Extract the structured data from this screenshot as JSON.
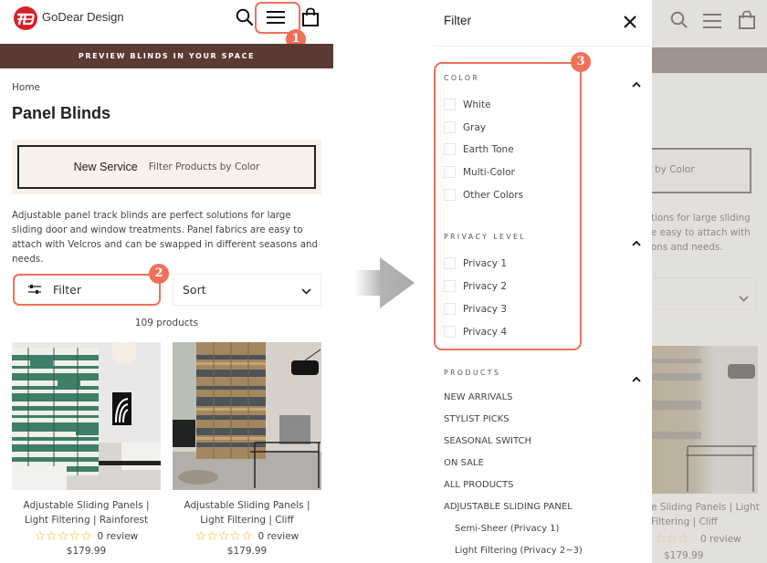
{
  "header": {
    "brand": "GoDear Design",
    "icons": [
      "search-icon",
      "menu-icon",
      "bag-icon"
    ]
  },
  "annotations": {
    "badge_1": "1",
    "badge_2": "2",
    "badge_3": "3",
    "accent_color": "#f0705a"
  },
  "promo_bar": {
    "text": "PREVIEW BLINDS IN YOUR SPACE",
    "color": "#5b3a33"
  },
  "breadcrumb": "Home",
  "page_title": "Panel Blinds",
  "service_banner": {
    "title": "New Service",
    "subtitle": "Filter Products by Color"
  },
  "description": "Adjustable panel track blinds are perfect solutions for large sliding door and window treatments. Panel fabrics are easy to attach with Velcros and can be swapped in different seasons and needs.",
  "toolbar": {
    "filter_label": "Filter",
    "sort_label": "Sort"
  },
  "product_count": "109 products",
  "products": [
    {
      "name": "Adjustable Sliding Panels | Light Filtering | Rainforest",
      "stars": "☆☆☆☆☆",
      "rating": 0,
      "reviews": "0 review",
      "price": "$179.99"
    },
    {
      "name": "Adjustable Sliding Panels | Light Filtering | Cliff",
      "stars": "☆☆☆☆☆",
      "rating": 0,
      "reviews": "0 review",
      "price": "$179.99"
    }
  ],
  "filter_drawer": {
    "title": "Filter",
    "sections": [
      {
        "heading": "COLOR",
        "options": [
          "White",
          "Gray",
          "Earth Tone",
          "Multi-Color",
          "Other Colors"
        ]
      },
      {
        "heading": "PRIVACY LEVEL",
        "options": [
          "Privacy 1",
          "Privacy 2",
          "Privacy 3",
          "Privacy 4"
        ]
      },
      {
        "heading": "PRODUCTS",
        "links": [
          "NEW ARRIVALS",
          "STYLIST PICKS",
          "SEASONAL SWITCH",
          "ON SALE",
          "ALL PRODUCTS",
          "ADJUSTABLE SLIDING PANEL"
        ],
        "sublinks": [
          "Semi-Sheer (Privacy 1)",
          "Light Filtering (Privacy 2~3)"
        ]
      }
    ]
  },
  "background_page": {
    "banner_fragment": "by Color",
    "desc_lines": [
      "tions for large sliding",
      "e easy to attach with",
      "ons and needs."
    ],
    "product_name_lines": [
      "e Sliding Panels | Light",
      "Filtering | Cliff"
    ],
    "stars": "☆☆☆",
    "reviews": "0 review",
    "price": "$179.99"
  }
}
